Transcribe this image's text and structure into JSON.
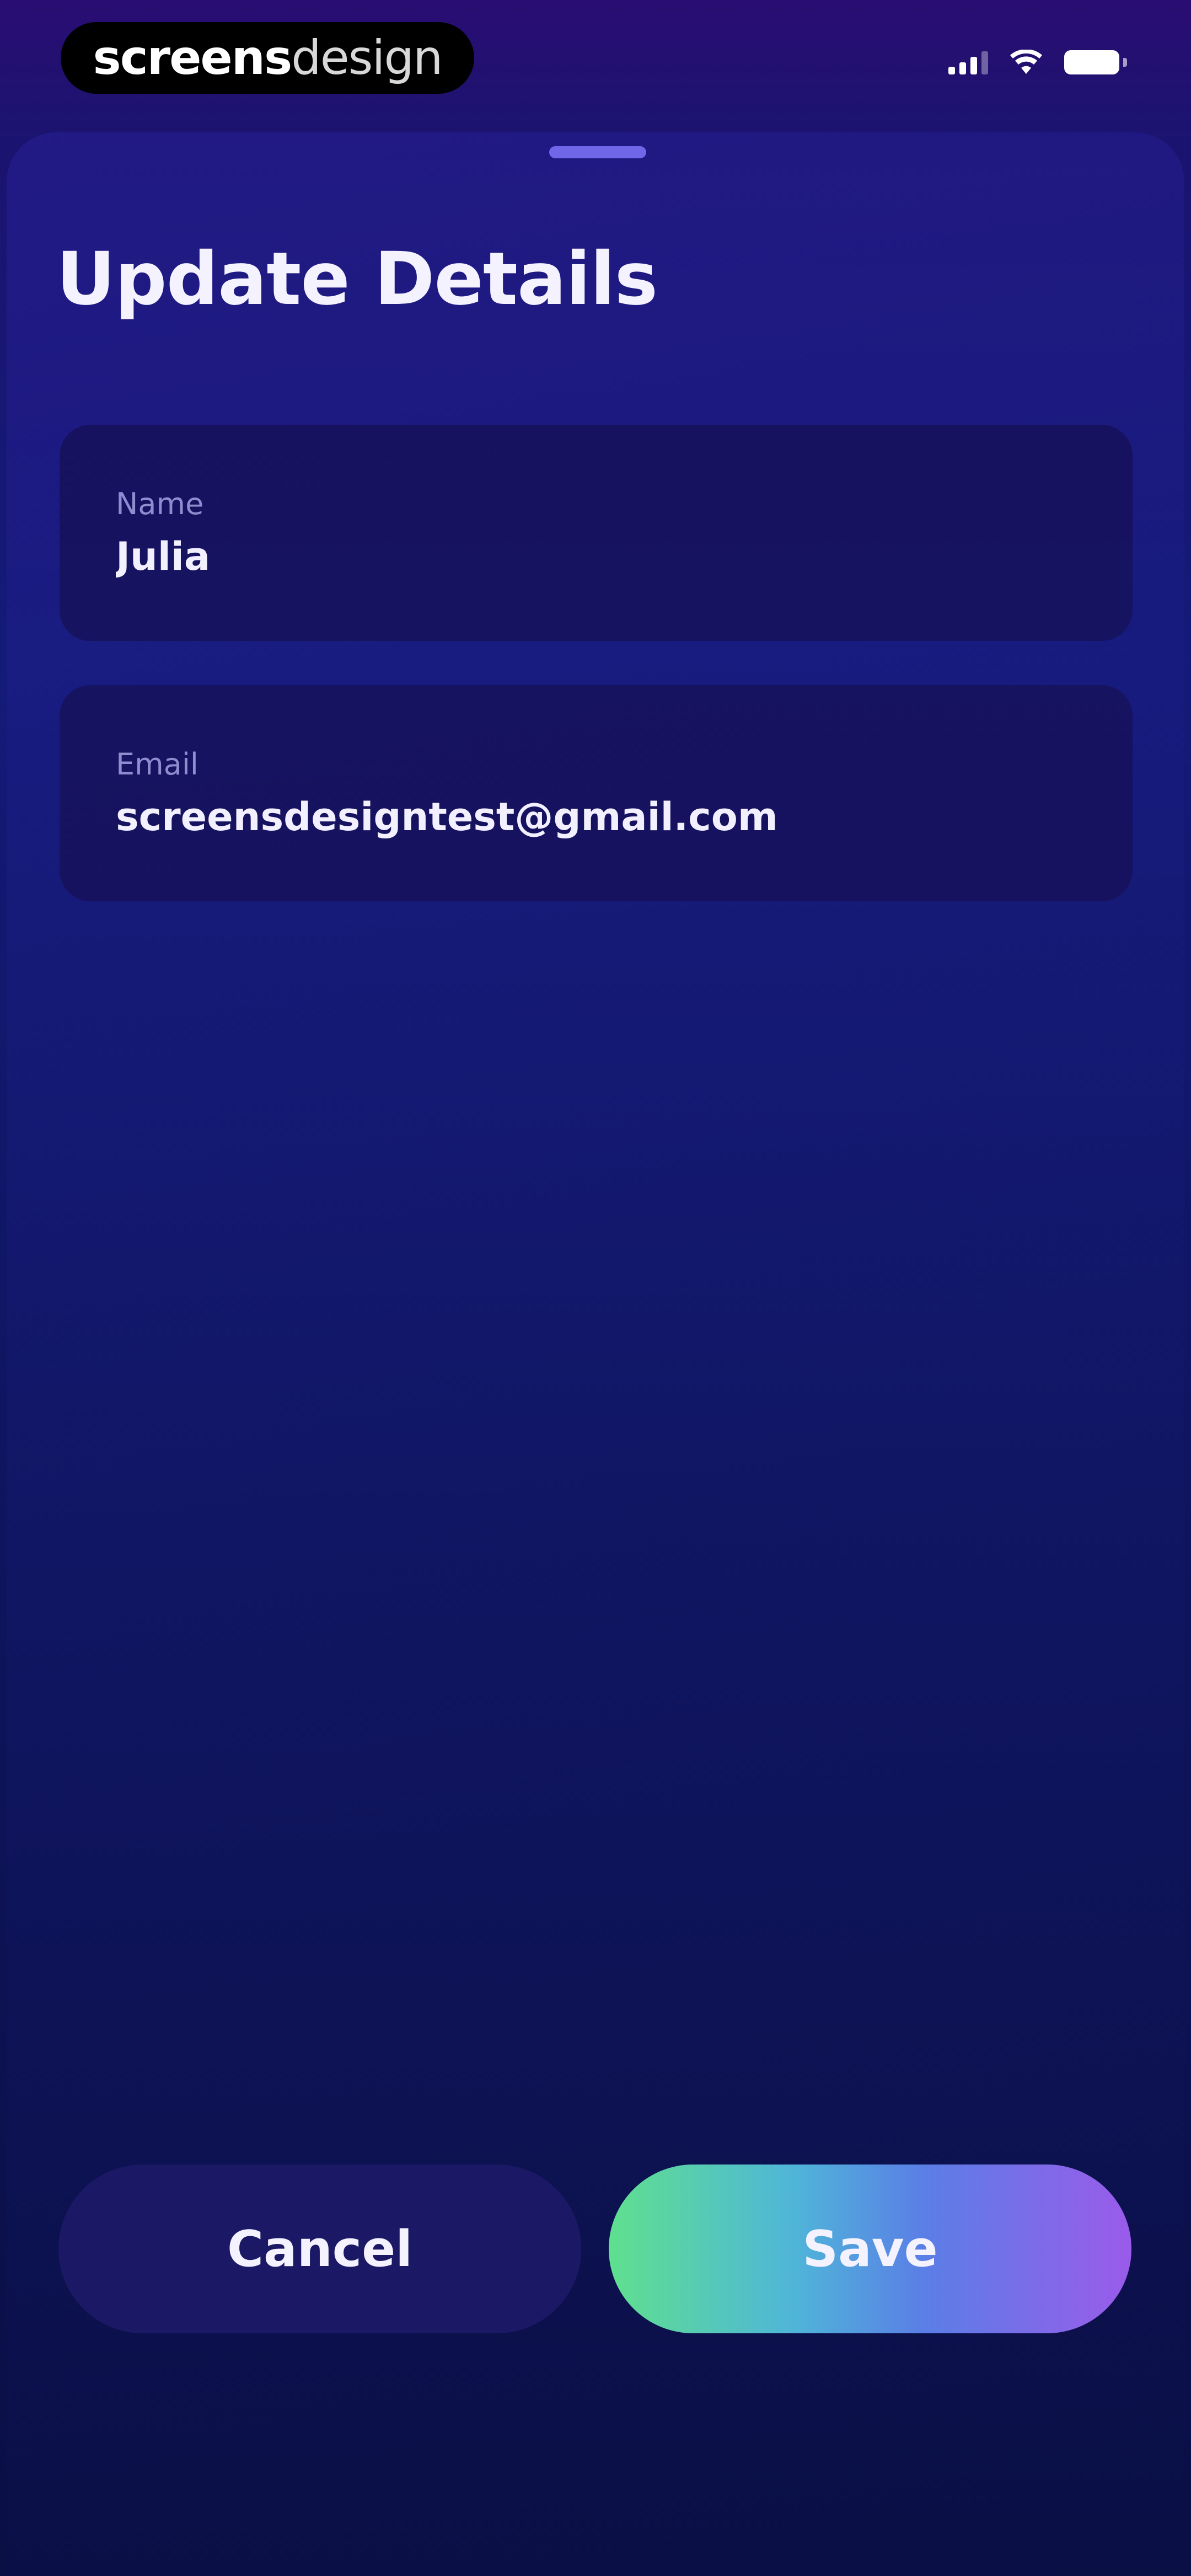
{
  "status_bar": {
    "brand_part_a": "screens",
    "brand_part_b": "design"
  },
  "sheet": {
    "title": "Update Details",
    "fields": [
      {
        "label": "Name",
        "value": "Julia"
      },
      {
        "label": "Email",
        "value": "screensdesigntest@gmail.com"
      }
    ]
  },
  "actions": {
    "cancel_label": "Cancel",
    "save_label": "Save"
  },
  "colors": {
    "background_top": "#2a0d72",
    "background_bottom": "#0a0f44",
    "save_gradient_start": "#5fe08e",
    "save_gradient_end": "#9a5bea"
  },
  "icons": {
    "signal": "signal-icon",
    "wifi": "wifi-icon",
    "battery": "battery-icon"
  }
}
